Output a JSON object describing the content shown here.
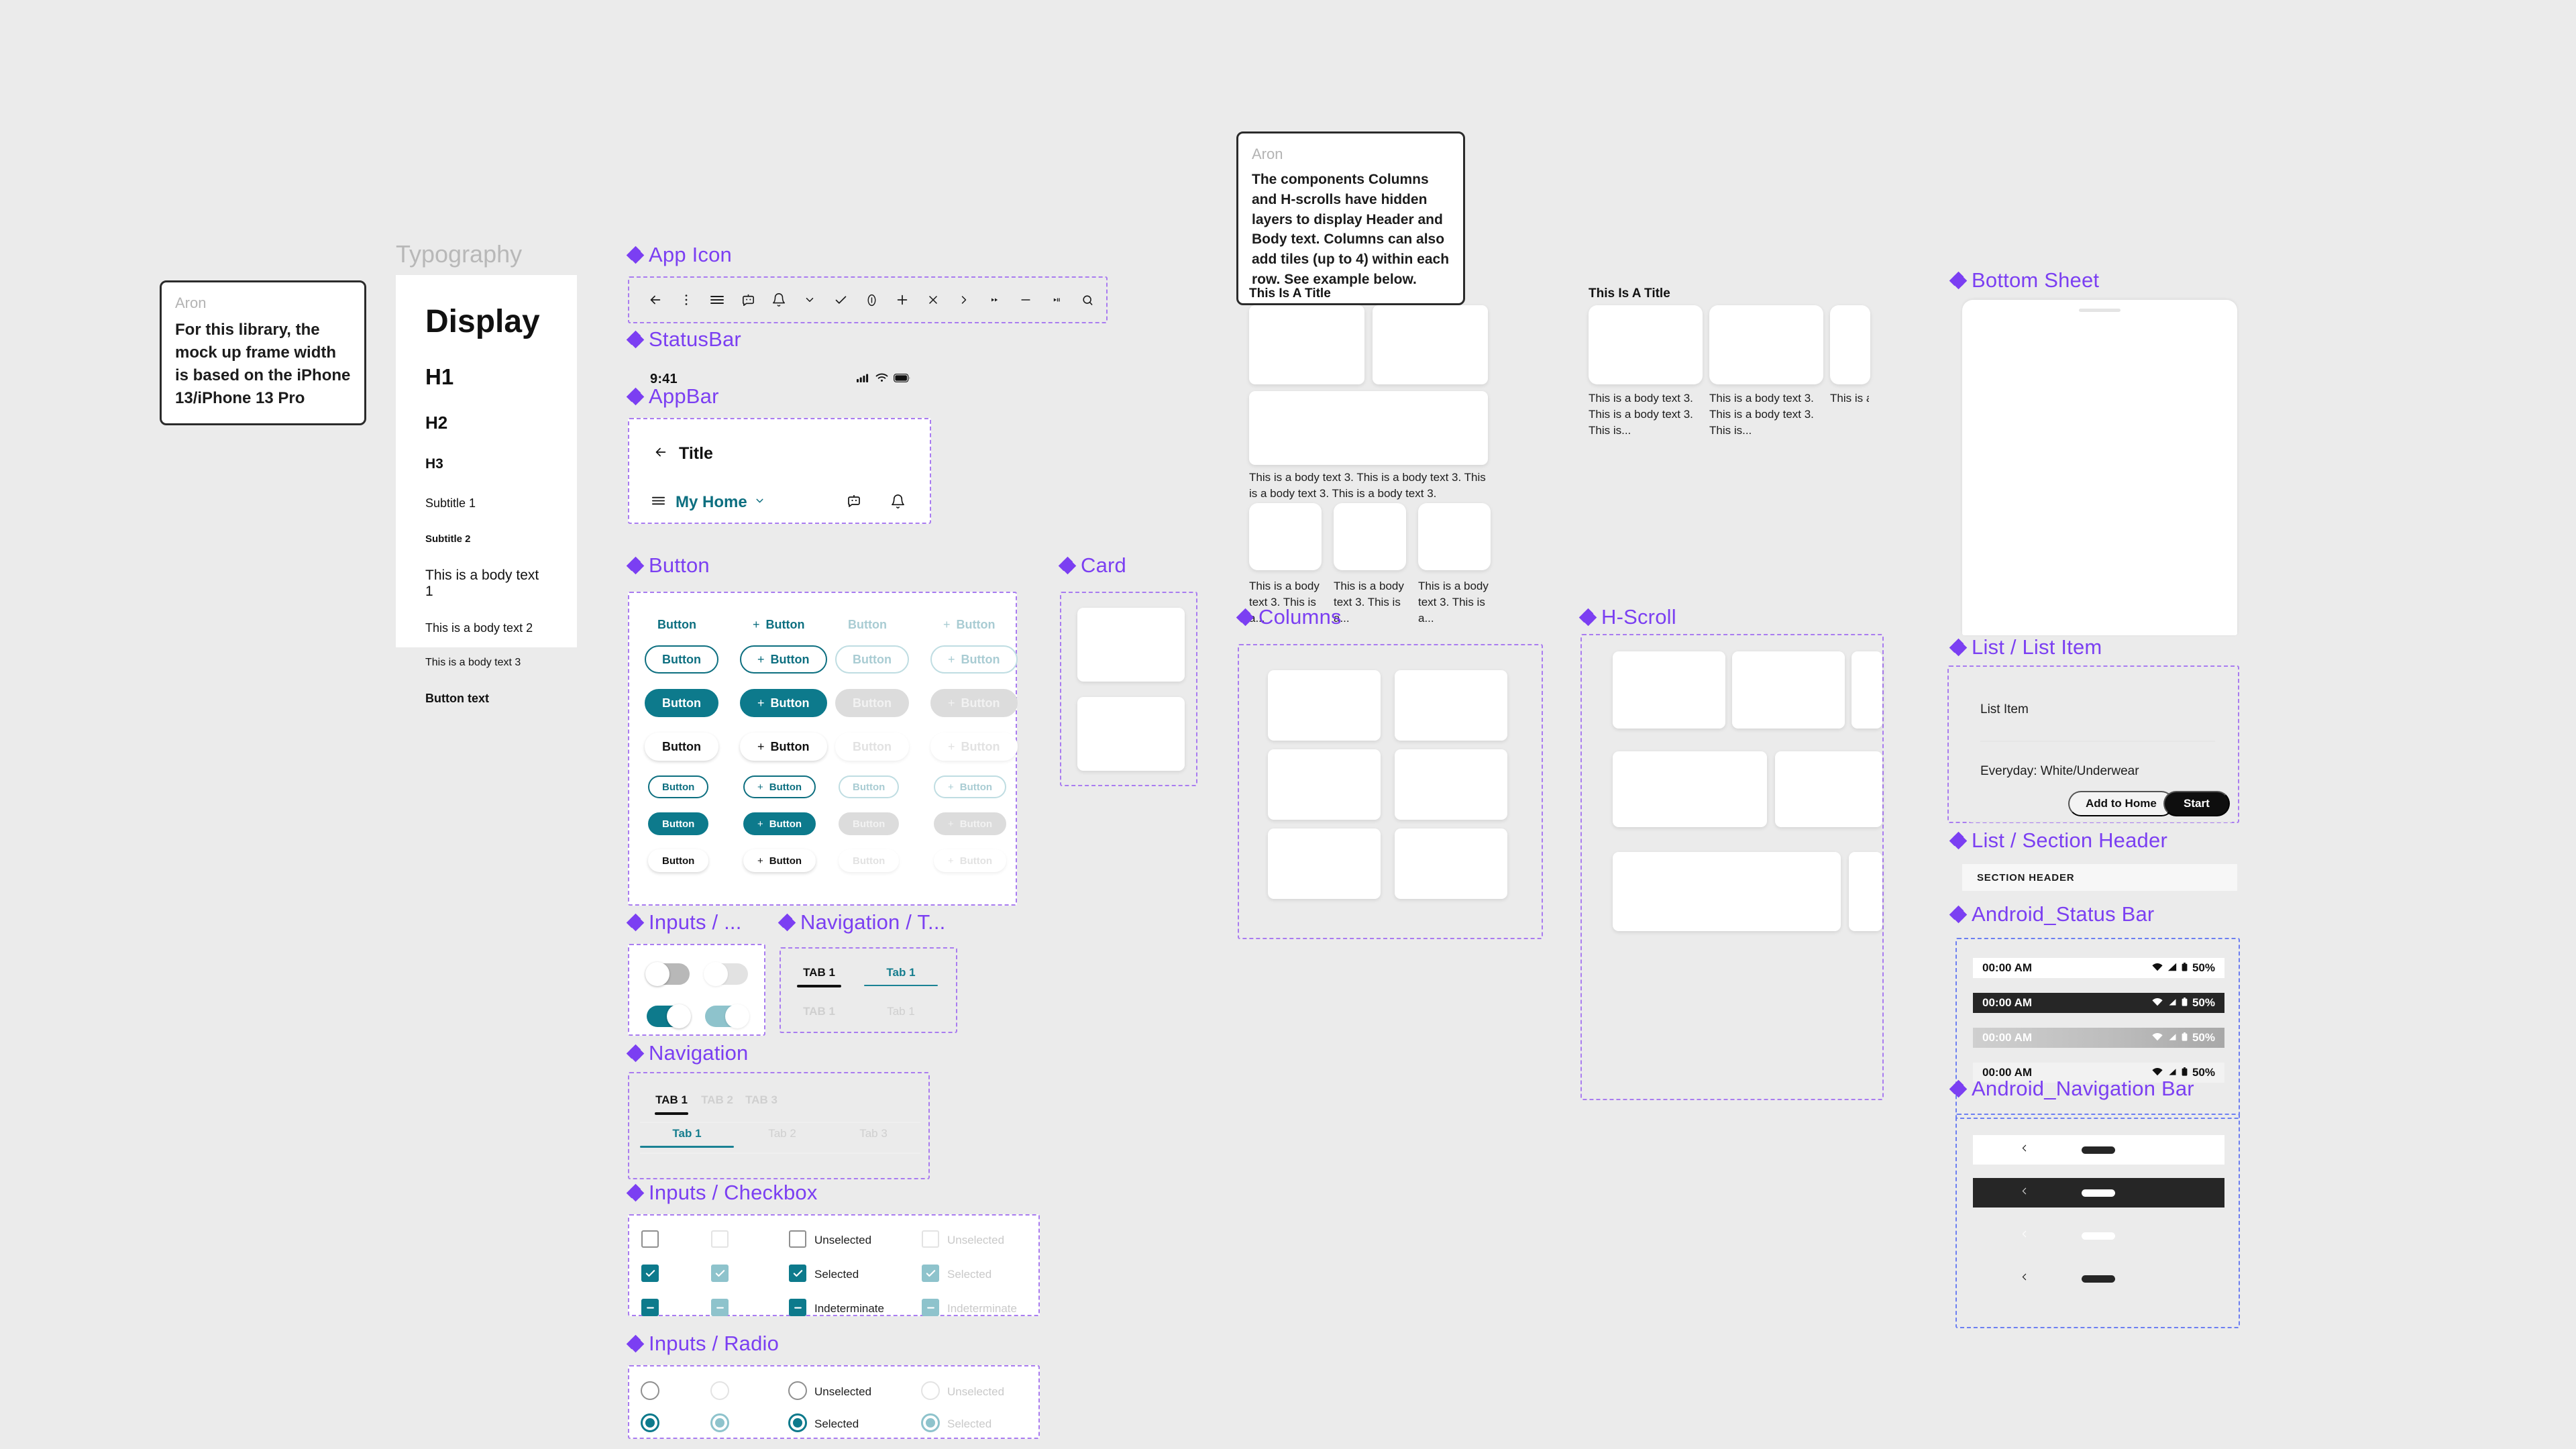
{
  "notes": [
    {
      "author": "Aron",
      "text": "For this library, the mock up frame width is based on the iPhone 13/iPhone 13 Pro"
    },
    {
      "author": "Aron",
      "text": "The components Columns and H-scrolls have hidden layers to display Header and Body text. Columns can also add tiles (up to 4) within each row. See example below."
    }
  ],
  "typography": {
    "section_title": "Typography",
    "samples": [
      {
        "id": "display",
        "label": "Display"
      },
      {
        "id": "h1",
        "label": "H1"
      },
      {
        "id": "h2",
        "label": "H2"
      },
      {
        "id": "h3",
        "label": "H3"
      },
      {
        "id": "sub1",
        "label": "Subtitle 1"
      },
      {
        "id": "sub2",
        "label": "Subtitle 2"
      },
      {
        "id": "body1",
        "label": "This is a body text 1"
      },
      {
        "id": "body2",
        "label": "This is a body text 2"
      },
      {
        "id": "body3",
        "label": "This is a body text 3"
      },
      {
        "id": "buttontext",
        "label": "Button text"
      }
    ]
  },
  "sections": {
    "app_icon": "App Icon",
    "status_bar": "StatusBar",
    "app_bar": "AppBar",
    "button": "Button",
    "inputs_toggle": "Inputs / ...",
    "navigation_tabs": "Navigation / T...",
    "navigation": "Navigation",
    "inputs_checkbox": "Inputs / Checkbox",
    "inputs_radio": "Inputs / Radio",
    "card": "Card",
    "columns": "Columns",
    "h_scroll": "H-Scroll",
    "bottom_sheet": "Bottom Sheet",
    "list_item": "List / List Item",
    "list_section_header": "List / Section Header",
    "android_status_bar": "Android_Status Bar",
    "android_navigation_bar": "Android_Navigation Bar"
  },
  "app_icons": [
    "arrow-left-icon",
    "more-vertical-icon",
    "menu-icon",
    "chat-bot-icon",
    "bell-icon",
    "chevron-down-icon",
    "check-icon",
    "info-icon",
    "plus-icon",
    "close-icon",
    "chevron-right-icon",
    "fast-forward-icon",
    "minus-icon",
    "skip-next-icon",
    "search-icon"
  ],
  "status_bar": {
    "time": "9:41",
    "icons": [
      "cellular-signal-icon",
      "wifi-icon",
      "battery-icon"
    ]
  },
  "app_bar": {
    "back_icon": "arrow-left-icon",
    "title": "Title",
    "menu_icon": "menu-icon",
    "home_label": "My Home",
    "dropdown_icon": "chevron-down-icon",
    "actions": [
      "chat-bot-icon",
      "bell-icon"
    ]
  },
  "button": {
    "label": "Button",
    "leading_icon": "plus-icon",
    "rows": [
      {
        "variant": "text",
        "size": "lg",
        "cells": [
          "enabled",
          "enabled-icon",
          "disabled",
          "disabled-icon"
        ]
      },
      {
        "variant": "outlined",
        "size": "lg",
        "cells": [
          "enabled",
          "enabled-icon",
          "disabled",
          "disabled-icon"
        ]
      },
      {
        "variant": "filled",
        "size": "lg",
        "cells": [
          "enabled",
          "enabled-icon",
          "disabled",
          "disabled-icon"
        ]
      },
      {
        "variant": "elevated",
        "size": "lg",
        "cells": [
          "enabled",
          "enabled-icon",
          "disabled",
          "disabled-icon"
        ]
      },
      {
        "variant": "outlined",
        "size": "sm",
        "cells": [
          "enabled",
          "enabled-icon",
          "disabled",
          "disabled-icon"
        ]
      },
      {
        "variant": "filled",
        "size": "sm",
        "cells": [
          "enabled",
          "enabled-icon",
          "disabled",
          "disabled-icon"
        ]
      },
      {
        "variant": "elevated",
        "size": "sm",
        "cells": [
          "enabled",
          "enabled-icon",
          "disabled",
          "disabled-icon"
        ]
      }
    ]
  },
  "toggles": [
    {
      "state": "off",
      "enabled": true
    },
    {
      "state": "off",
      "enabled": false
    },
    {
      "state": "on",
      "enabled": true
    },
    {
      "state": "on",
      "enabled": false
    }
  ],
  "nav_tabs_small": {
    "active_upper": "TAB 1",
    "active_lower": "Tab 1",
    "inactive_upper": "TAB 1",
    "inactive_lower": "Tab 1"
  },
  "navigation": {
    "upper": [
      {
        "label": "TAB 1",
        "active": true
      },
      {
        "label": "TAB 2",
        "active": false
      },
      {
        "label": "TAB 3",
        "active": false
      }
    ],
    "lower": [
      {
        "label": "Tab 1",
        "active": true
      },
      {
        "label": "Tab 2",
        "active": false
      },
      {
        "label": "Tab 3",
        "active": false
      }
    ]
  },
  "checkbox": {
    "rows": [
      {
        "state": "unselected",
        "label": "Unselected"
      },
      {
        "state": "selected",
        "label": "Selected"
      },
      {
        "state": "indeterminate",
        "label": "Indeterminate"
      }
    ]
  },
  "radio": {
    "rows": [
      {
        "state": "unselected",
        "label": "Unselected"
      },
      {
        "state": "selected",
        "label": "Selected"
      }
    ]
  },
  "columns_example": {
    "title": "This Is A Title",
    "body_long": "This is a body text 3. This is a body text 3. This is a body text 3. This is a body text 3.",
    "body_short": "This is a body text 3. This is a...",
    "tile_count_row1": 2,
    "tile_count_row2": 1,
    "tile_count_row3": 3
  },
  "hscroll_example": {
    "title": "This Is A Title",
    "body": "This is a body text 3. This is a body text 3. This is...",
    "body_clipped": "This is a b"
  },
  "columns_component": {
    "rows": 3,
    "cols": 2
  },
  "hscroll_component": {
    "rows": 3
  },
  "card_component": {
    "count": 2
  },
  "bottom_sheet": {
    "grab_handle": "drag-handle"
  },
  "list_item": {
    "title": "List Item",
    "subtitle": "Everyday: White/Underwear",
    "secondary_button": "Add to Home",
    "primary_button": "Start"
  },
  "section_header": {
    "label": "SECTION HEADER"
  },
  "android_status_bar": {
    "time": "00:00 AM",
    "battery": "50%",
    "icons": [
      "wifi-icon",
      "cellular-signal-icon",
      "battery-icon"
    ],
    "variants": [
      "light",
      "dark",
      "gradient",
      "grey"
    ]
  },
  "android_navigation_bar": {
    "back_icon": "chevron-left-icon",
    "home_handle": "home-indicator",
    "variants": [
      "light",
      "dark",
      "transparent-light",
      "transparent-dark"
    ]
  },
  "colors": {
    "canvas": "#ebebeb",
    "figma_purple": "#7b3ff2",
    "frame_purple": "#a97cf0",
    "frame_blue": "#6c7ff2",
    "teal": "#0d7a8c",
    "teal_text": "#0d6f80",
    "teal_disabled": "#8ec3cc",
    "grey_disabled": "#dcdcdc",
    "black": "#0e0e0e"
  }
}
